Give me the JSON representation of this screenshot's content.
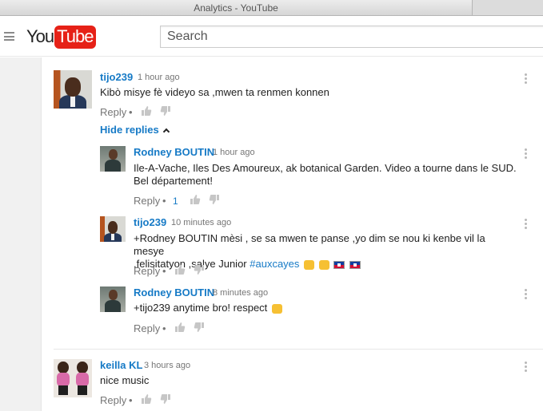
{
  "window": {
    "title": "Analytics - YouTube"
  },
  "masthead": {
    "logo_you": "You",
    "logo_tube": "Tube",
    "search_placeholder": "Search"
  },
  "colors": {
    "link": "#167ac6",
    "brand_red": "#e62117",
    "muted": "#767676"
  },
  "comments": [
    {
      "author": "tijo239",
      "time": "1 hour ago",
      "text": "Kibò misye fè videyo sa ,mwen ta renmen konnen",
      "reply_label": "Reply",
      "dot": "•",
      "hide_replies_label": "Hide replies",
      "replies": [
        {
          "author": "Rodney BOUTIN",
          "time": "1 hour ago",
          "text_line1": "Ile-A-Vache, Iles Des Amoureux, ak botanical Garden. Video a tourne dans le SUD.",
          "text_line2": "Bel département!",
          "reply_label": "Reply",
          "dot": "•",
          "likes": "1"
        },
        {
          "author": "tijo239",
          "time": "10 minutes ago",
          "text_line1": "+Rodney BOUTIN mèsi , se sa mwen te panse ,yo dim se nou ki kenbe vil la mesye",
          "text_line2": ",felisitatyon ,salye Junior",
          "hashtag": "#auxcayes",
          "emoji": [
            "thumbs-up-emoji",
            "thumbs-up-emoji",
            "haiti-flag-emoji",
            "haiti-flag-emoji"
          ],
          "reply_label": "Reply",
          "dot": "•"
        },
        {
          "author": "Rodney BOUTIN",
          "time": "8 minutes ago",
          "text": "+tijo239 anytime bro! respect",
          "emoji": [
            "fist-bump-emoji"
          ],
          "reply_label": "Reply",
          "dot": "•"
        }
      ]
    },
    {
      "author": "keilla KL",
      "time": "3 hours ago",
      "text": "nice music",
      "reply_label": "Reply",
      "dot": "•"
    }
  ]
}
